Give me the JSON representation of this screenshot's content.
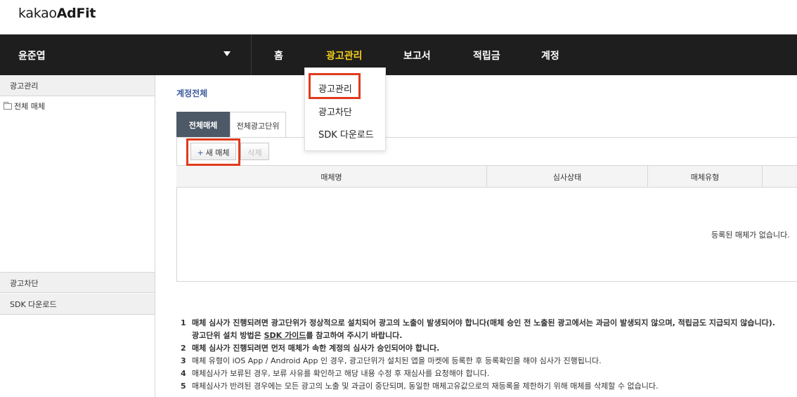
{
  "brand": {
    "logo_prefix": "kakao",
    "logo_suffix": "AdFit"
  },
  "topnav": {
    "account_name": "윤준엽",
    "items": [
      {
        "label": "홈",
        "active": false
      },
      {
        "label": "광고관리",
        "active": true
      },
      {
        "label": "보고서",
        "active": false
      },
      {
        "label": "적립금",
        "active": false
      },
      {
        "label": "계정",
        "active": false
      }
    ],
    "active_color": "#f5cf1b",
    "background": "#1e1e1e"
  },
  "dropdown": {
    "items": [
      "광고관리",
      "광고차단",
      "SDK 다운로드"
    ],
    "highlighted": "광고관리"
  },
  "sidebar": {
    "sections": [
      "광고관리",
      "광고차단",
      "SDK 다운로드"
    ],
    "tree_item": "전체 매체"
  },
  "main": {
    "title": "계정전체",
    "tabs": [
      {
        "label": "전체매체",
        "active": true
      },
      {
        "label": "전체광고단위",
        "active": false
      }
    ],
    "buttons": {
      "new": "새 매체",
      "new_icon": "+",
      "delete": "삭제"
    },
    "table": {
      "columns": [
        "매체명",
        "심사상태",
        "매체유형"
      ],
      "empty_message": "등록된 매체가 없습니다."
    }
  },
  "notes": [
    {
      "num": "1",
      "text": "매체 심사가 진행되려면 광고단위가 정상적으로 설치되어 광고의 노출이 발생되어야 합니다(매체 승인 전 노출된 광고에서는 과금이 발생되지 않으며, 적립금도 지급되지 않습니다).",
      "bold": true
    },
    {
      "num": "",
      "text_before": "광고단위 설치 방법은 ",
      "link": "SDK 가이드",
      "text_after": "를 참고하여 주시기 바랍니다.",
      "bold": true
    },
    {
      "num": "2",
      "text": "매체 심사가 진행되려면 먼저 매체가 속한 계정의 심사가 승인되어야 합니다.",
      "bold": true
    },
    {
      "num": "3",
      "text": "매체 유형이 iOS App / Android App 인 경우, 광고단위가 설치된 앱을 마켓에 등록한 후 등록확인을 해야 심사가 진행됩니다.",
      "bold": false
    },
    {
      "num": "4",
      "text": "매체심사가 보류된 경우, 보류 사유를 확인하고 해당 내용 수정 후 재심사를 요청해야 합니다.",
      "bold": false
    },
    {
      "num": "5",
      "text": "매체심사가 반려된 경우에는 모든 광고의 노출 및 과금이 중단되며, 동일한 매체고유값으로의 재등록을 제한하기 위해 매체를 삭제할 수 없습니다.",
      "bold": false
    }
  ],
  "highlight_color": "#e03a1e"
}
